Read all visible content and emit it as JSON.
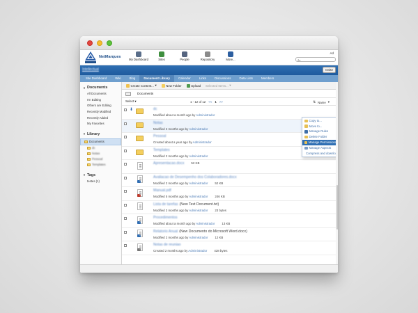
{
  "window": {
    "buttons": [
      "close",
      "minimize",
      "maximize"
    ]
  },
  "app": {
    "brand": "NetMarques",
    "user_label": "Ad",
    "search": {
      "icon": "search-icon",
      "placeholder": ""
    },
    "nav": [
      {
        "label": "My Dashboard",
        "icon": "dashboard-icon",
        "color": "#5a6e8a"
      },
      {
        "label": "Sites",
        "icon": "sites-icon",
        "color": "#3f8f3f"
      },
      {
        "label": "People",
        "icon": "people-icon",
        "color": "#566580"
      },
      {
        "label": "Repository",
        "icon": "repository-icon",
        "color": "#8a8a8a"
      },
      {
        "label": "More...",
        "icon": "more-icon",
        "color": "#2d5fa0"
      }
    ]
  },
  "site": {
    "title": "Intellectual",
    "invite_label": "Invite",
    "tabs": [
      "Site Dashboard",
      "Wiki",
      "Blog",
      "Document Library",
      "Calendar",
      "Links",
      "Discussions",
      "Data Lists",
      "Members"
    ],
    "active_tab": "Document Library"
  },
  "sidebar": {
    "documents_header": "Documents",
    "documents_items": [
      "All Documents",
      "I'm Editing",
      "Others are Editing",
      "Recently Modified",
      "Recently Added",
      "My Favorites"
    ],
    "library_header": "Library",
    "library_root": "Documents",
    "library_children": [
      "dc",
      "Notas",
      "Pessoal",
      "Templates"
    ],
    "tags_header": "Tags",
    "tags": [
      "testes (1)"
    ]
  },
  "toolbar": {
    "create_label": "Create Content...",
    "new_folder_label": "New Folder",
    "upload_label": "Upload",
    "selected_items_label": "Selected Items..."
  },
  "breadcrumb": {
    "label": "Documents"
  },
  "listbar": {
    "select_label": "Select",
    "page_info": "1 - 12 of 12",
    "prev": "<<",
    "page": "1",
    "next": ">>",
    "sort_label": "Name"
  },
  "rows": [
    {
      "type": "folder",
      "name": "dc",
      "meta": "Modified about a month ago by",
      "by": "Administrador",
      "size": "",
      "paren": "",
      "badge": "",
      "extra": "arrow-down-icon"
    },
    {
      "type": "folder",
      "name": "Notas",
      "meta": "Modified 2 months ago by",
      "by": "Administrador",
      "size": "",
      "paren": "",
      "badge": "",
      "extra": "",
      "highlight": true
    },
    {
      "type": "folder",
      "name": "Pessoal",
      "meta": "Created about a year ago by",
      "by": "Administrador",
      "size": "",
      "paren": "",
      "badge": "",
      "extra": ""
    },
    {
      "type": "folder",
      "name": "Templates",
      "meta": "Modified 2 months ago by",
      "by": "Administrador",
      "size": "",
      "paren": "",
      "badge": "",
      "extra": ""
    },
    {
      "type": "doc",
      "name": "Apresentacao.docx",
      "meta": "Modified 10 days ago by",
      "by": "Administrador",
      "size": "52 KB",
      "paren": "",
      "badge": "",
      "extra": "",
      "size_inline": true
    },
    {
      "type": "doc",
      "name": "Avaliacao de Desempenho dos Colaboradores.docx",
      "meta": "Modified 2 months ago by",
      "by": "Administrador",
      "size": "52 KB",
      "paren": "",
      "badge": "#2d6db5",
      "extra": ""
    },
    {
      "type": "doc",
      "name": "Manual.pdf",
      "meta": "Modified 5 months ago by",
      "by": "Administrador",
      "size": "246 KB",
      "paren": "",
      "badge": "#c0392b",
      "extra": ""
    },
    {
      "type": "doc",
      "name": "Lista de tarefas",
      "meta": "Modified 2 months ago by",
      "by": "Administrador",
      "size": "23 bytes",
      "paren": "(New Text Document.txt)",
      "badge": "",
      "extra": ""
    },
    {
      "type": "doc",
      "name": "Procedimentos",
      "meta": "Modified about a month ago by",
      "by": "Administrador",
      "size": "13 KB",
      "paren": "",
      "badge": "#2d6db5",
      "extra": "",
      "size_inline_only": true
    },
    {
      "type": "doc",
      "name": "Relatorio Anual",
      "meta": "Modified 2 months ago by",
      "by": "Administrador",
      "size": "12 KB",
      "paren": "(New Documento do Microsoft Word.docx)",
      "badge": "#2d6db5",
      "extra": ""
    },
    {
      "type": "doc",
      "name": "Notas de reuniao",
      "meta": "Created 2 months ago by",
      "by": "Administrador",
      "size": "428 bytes",
      "paren": "",
      "badge": "#777777",
      "extra": ""
    }
  ],
  "context_menu": {
    "items": [
      {
        "label": "Copy to...",
        "icon": "copy-icon",
        "color": "#e7c055"
      },
      {
        "label": "Move to...",
        "icon": "move-icon",
        "color": "#e7c055"
      },
      {
        "label": "Manage Rules",
        "icon": "rules-icon",
        "color": "#3e6ea8"
      },
      {
        "label": "Delete Folder",
        "icon": "delete-icon",
        "color": "#e7c055"
      },
      {
        "label": "Manage Permissions",
        "icon": "permissions-icon",
        "color": "#e7c055",
        "active": true
      },
      {
        "label": "Manage Aspects",
        "icon": "aspects-icon",
        "color": "#7a9cc6"
      },
      {
        "label": "Compress and download",
        "icon": "compress-icon",
        "color": "#7a9cc6"
      }
    ]
  }
}
